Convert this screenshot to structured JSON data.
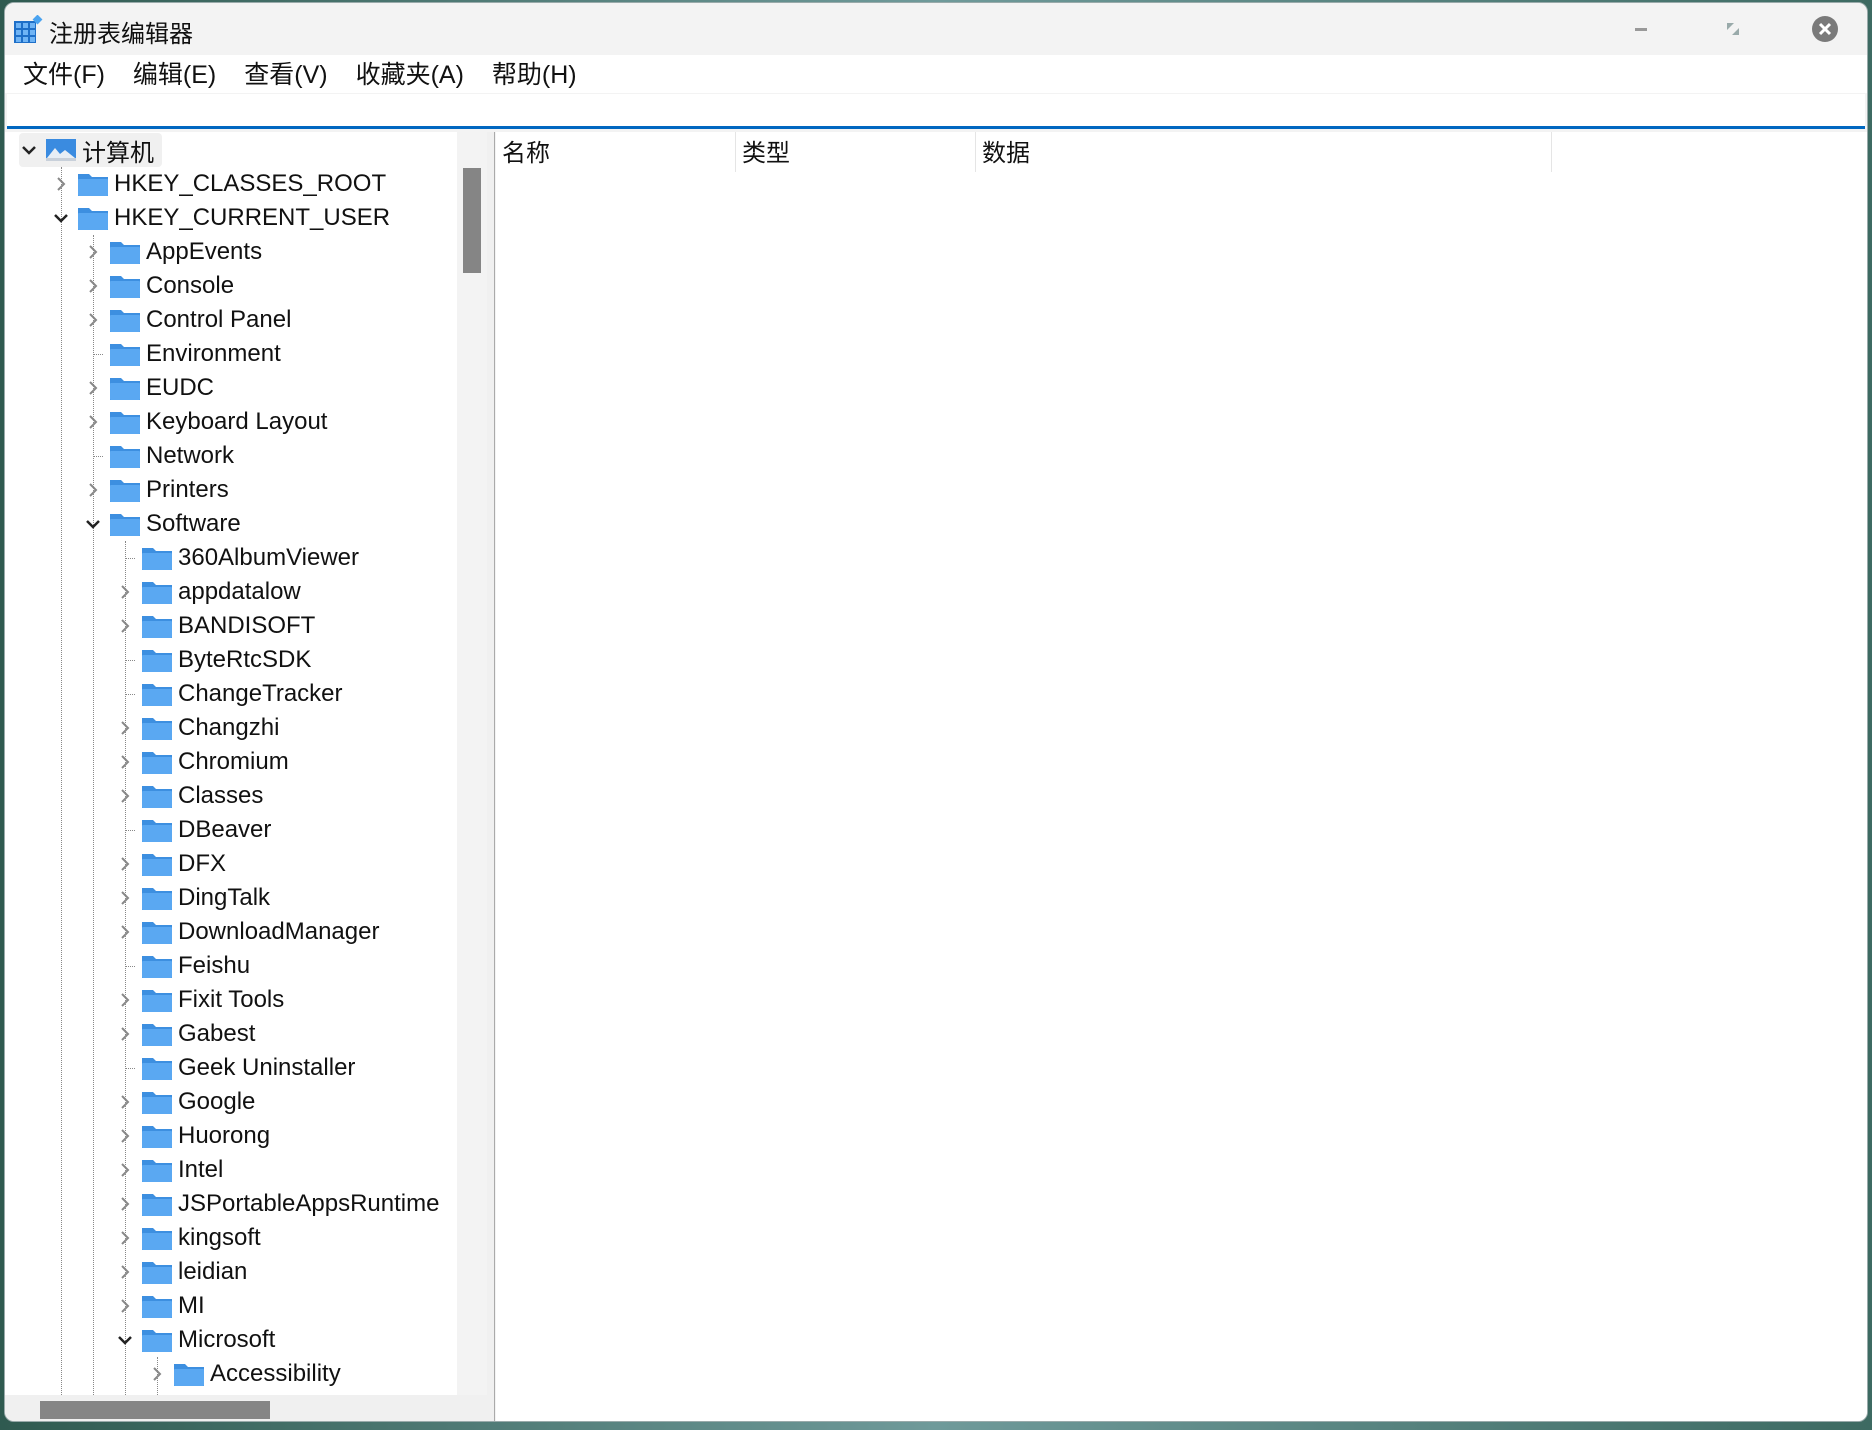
{
  "window": {
    "title": "注册表编辑器"
  },
  "menu": [
    "文件(F)",
    "编辑(E)",
    "查看(V)",
    "收藏夹(A)",
    "帮助(H)"
  ],
  "address": {
    "value": ""
  },
  "list": {
    "columns": [
      "名称",
      "类型",
      "数据"
    ]
  },
  "tree": [
    {
      "label": "计算机",
      "level": 0,
      "exp": "open",
      "icon": "computer"
    },
    {
      "label": "HKEY_CLASSES_ROOT",
      "level": 1,
      "exp": "closed"
    },
    {
      "label": "HKEY_CURRENT_USER",
      "level": 1,
      "exp": "open"
    },
    {
      "label": "AppEvents",
      "level": 2,
      "exp": "closed"
    },
    {
      "label": "Console",
      "level": 2,
      "exp": "closed"
    },
    {
      "label": "Control Panel",
      "level": 2,
      "exp": "closed"
    },
    {
      "label": "Environment",
      "level": 2,
      "exp": "none"
    },
    {
      "label": "EUDC",
      "level": 2,
      "exp": "closed"
    },
    {
      "label": "Keyboard Layout",
      "level": 2,
      "exp": "closed"
    },
    {
      "label": "Network",
      "level": 2,
      "exp": "none"
    },
    {
      "label": "Printers",
      "level": 2,
      "exp": "closed"
    },
    {
      "label": "Software",
      "level": 2,
      "exp": "open"
    },
    {
      "label": "360AlbumViewer",
      "level": 3,
      "exp": "none"
    },
    {
      "label": "appdatalow",
      "level": 3,
      "exp": "closed"
    },
    {
      "label": "BANDISOFT",
      "level": 3,
      "exp": "closed"
    },
    {
      "label": "ByteRtcSDK",
      "level": 3,
      "exp": "none"
    },
    {
      "label": "ChangeTracker",
      "level": 3,
      "exp": "none"
    },
    {
      "label": "Changzhi",
      "level": 3,
      "exp": "closed"
    },
    {
      "label": "Chromium",
      "level": 3,
      "exp": "closed"
    },
    {
      "label": "Classes",
      "level": 3,
      "exp": "closed"
    },
    {
      "label": "DBeaver",
      "level": 3,
      "exp": "none"
    },
    {
      "label": "DFX",
      "level": 3,
      "exp": "closed"
    },
    {
      "label": "DingTalk",
      "level": 3,
      "exp": "closed"
    },
    {
      "label": "DownloadManager",
      "level": 3,
      "exp": "closed"
    },
    {
      "label": "Feishu",
      "level": 3,
      "exp": "none"
    },
    {
      "label": "Fixit Tools",
      "level": 3,
      "exp": "closed"
    },
    {
      "label": "Gabest",
      "level": 3,
      "exp": "closed"
    },
    {
      "label": "Geek Uninstaller",
      "level": 3,
      "exp": "none"
    },
    {
      "label": "Google",
      "level": 3,
      "exp": "closed"
    },
    {
      "label": "Huorong",
      "level": 3,
      "exp": "closed"
    },
    {
      "label": "Intel",
      "level": 3,
      "exp": "closed"
    },
    {
      "label": "JSPortableAppsRuntime",
      "level": 3,
      "exp": "closed"
    },
    {
      "label": "kingsoft",
      "level": 3,
      "exp": "closed"
    },
    {
      "label": "leidian",
      "level": 3,
      "exp": "closed"
    },
    {
      "label": "MI",
      "level": 3,
      "exp": "closed"
    },
    {
      "label": "Microsoft",
      "level": 3,
      "exp": "open"
    },
    {
      "label": "Accessibility",
      "level": 4,
      "exp": "closed"
    }
  ],
  "colors": {
    "accent": "#0067c0",
    "folder": "#4a9ff0",
    "scroll_thumb": "#858585"
  }
}
